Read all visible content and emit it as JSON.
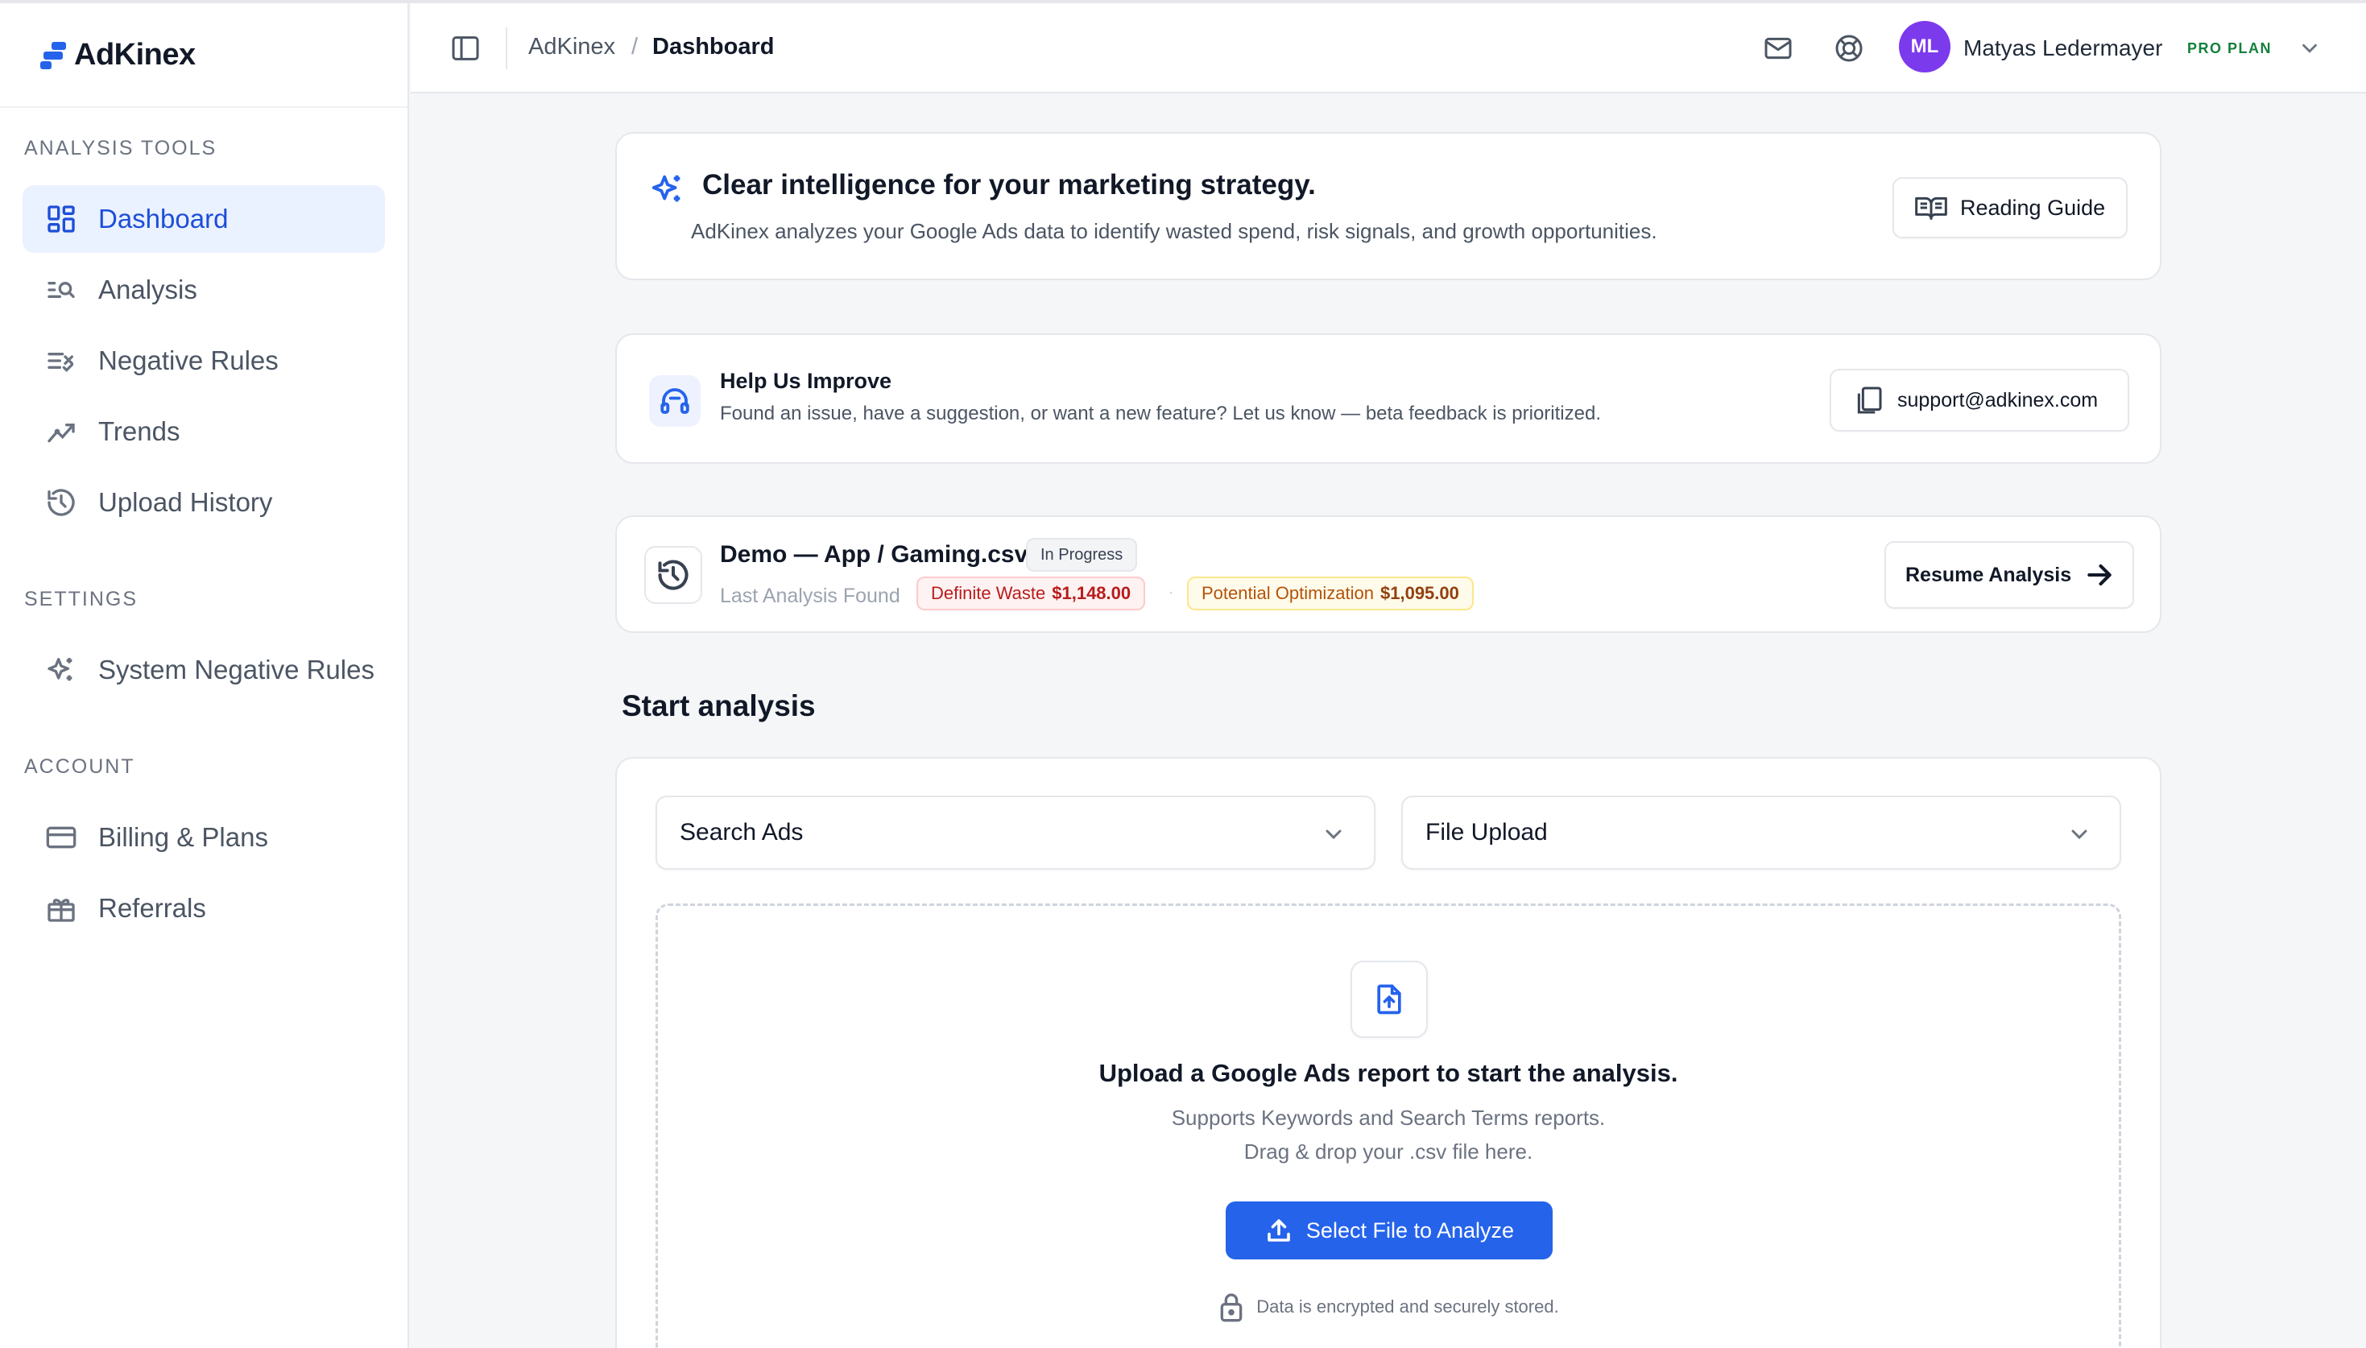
{
  "app": {
    "name": "AdKinex"
  },
  "sidebar": {
    "sections": [
      {
        "label": "ANALYSIS TOOLS"
      },
      {
        "label": "SETTINGS"
      },
      {
        "label": "ACCOUNT"
      }
    ],
    "items": [
      {
        "label": "Dashboard",
        "icon": "dashboard-grid-icon",
        "active": true
      },
      {
        "label": "Analysis",
        "icon": "list-search-icon"
      },
      {
        "label": "Negative Rules",
        "icon": "list-x-icon"
      },
      {
        "label": "Trends",
        "icon": "trend-line-icon"
      },
      {
        "label": "Upload History",
        "icon": "history-icon"
      },
      {
        "label": "System Negative Rules",
        "icon": "sparkles-icon"
      },
      {
        "label": "Billing & Plans",
        "icon": "credit-card-icon"
      },
      {
        "label": "Referrals",
        "icon": "gift-icon"
      }
    ]
  },
  "header": {
    "breadcrumb": {
      "root": "AdKinex",
      "separator": "/",
      "current": "Dashboard"
    },
    "user": {
      "initials": "ML",
      "name": "Matyas Ledermayer",
      "plan": "PRO PLAN"
    }
  },
  "intro": {
    "title": "Clear intelligence for your marketing strategy.",
    "subtitle": "AdKinex analyzes your Google Ads data to identify wasted spend, risk signals, and growth opportunities.",
    "guide_button": "Reading Guide"
  },
  "feedback": {
    "title": "Help Us Improve",
    "text": "Found an issue, have a suggestion, or want a new feature? Let us know — beta feedback is prioritized.",
    "email_button": "support@adkinex.com"
  },
  "last_analysis": {
    "file": "Demo — App / Gaming.csv",
    "status": "In Progress",
    "label": "Last Analysis Found",
    "waste_label": "Definite Waste",
    "waste_value": "$1,148.00",
    "opt_label": "Potential Optimization",
    "opt_value": "$1,095.00",
    "resume_button": "Resume Analysis"
  },
  "start": {
    "heading": "Start analysis",
    "campaign_type": "Search Ads",
    "source": "File Upload",
    "upload_title": "Upload a Google Ads report to start the analysis.",
    "upload_line1": "Supports Keywords and Search Terms reports.",
    "upload_line2": "Drag & drop your .csv file here.",
    "select_button": "Select File to Analyze",
    "security_note": "Data is encrypted and securely stored."
  },
  "colors": {
    "accent": "#2563eb",
    "active_bg": "#eaf1ff",
    "avatar": "#7c3aed",
    "plan": "#15803d",
    "waste_bg": "#fef2f2",
    "waste_text": "#b91c1c",
    "opt_bg": "#fffbeb",
    "opt_text": "#b45309"
  }
}
